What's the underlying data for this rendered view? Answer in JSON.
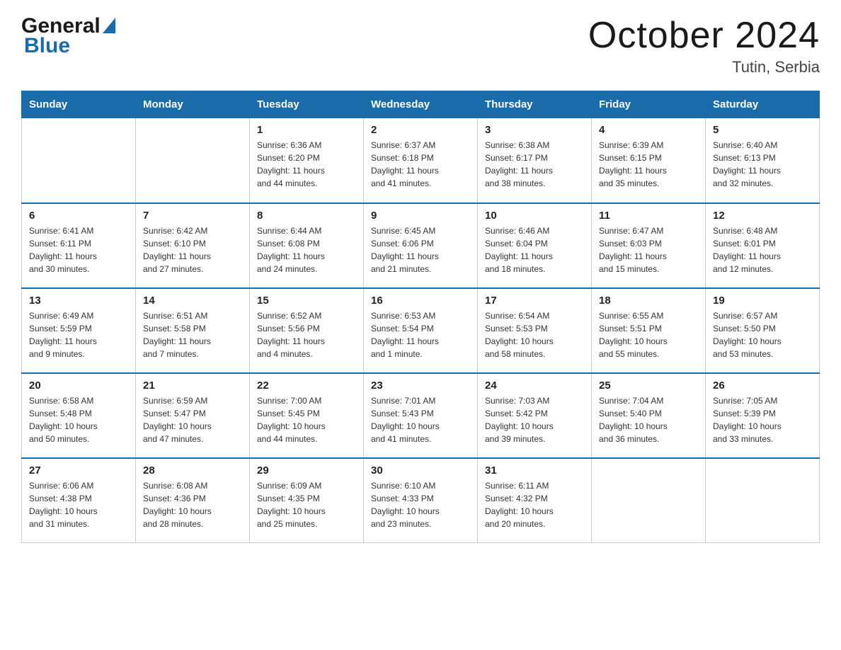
{
  "header": {
    "logo_general": "General",
    "logo_blue": "Blue",
    "month_title": "October 2024",
    "subtitle": "Tutin, Serbia"
  },
  "days_of_week": [
    "Sunday",
    "Monday",
    "Tuesday",
    "Wednesday",
    "Thursday",
    "Friday",
    "Saturday"
  ],
  "weeks": [
    [
      {
        "day": "",
        "info": ""
      },
      {
        "day": "",
        "info": ""
      },
      {
        "day": "1",
        "info": "Sunrise: 6:36 AM\nSunset: 6:20 PM\nDaylight: 11 hours\nand 44 minutes."
      },
      {
        "day": "2",
        "info": "Sunrise: 6:37 AM\nSunset: 6:18 PM\nDaylight: 11 hours\nand 41 minutes."
      },
      {
        "day": "3",
        "info": "Sunrise: 6:38 AM\nSunset: 6:17 PM\nDaylight: 11 hours\nand 38 minutes."
      },
      {
        "day": "4",
        "info": "Sunrise: 6:39 AM\nSunset: 6:15 PM\nDaylight: 11 hours\nand 35 minutes."
      },
      {
        "day": "5",
        "info": "Sunrise: 6:40 AM\nSunset: 6:13 PM\nDaylight: 11 hours\nand 32 minutes."
      }
    ],
    [
      {
        "day": "6",
        "info": "Sunrise: 6:41 AM\nSunset: 6:11 PM\nDaylight: 11 hours\nand 30 minutes."
      },
      {
        "day": "7",
        "info": "Sunrise: 6:42 AM\nSunset: 6:10 PM\nDaylight: 11 hours\nand 27 minutes."
      },
      {
        "day": "8",
        "info": "Sunrise: 6:44 AM\nSunset: 6:08 PM\nDaylight: 11 hours\nand 24 minutes."
      },
      {
        "day": "9",
        "info": "Sunrise: 6:45 AM\nSunset: 6:06 PM\nDaylight: 11 hours\nand 21 minutes."
      },
      {
        "day": "10",
        "info": "Sunrise: 6:46 AM\nSunset: 6:04 PM\nDaylight: 11 hours\nand 18 minutes."
      },
      {
        "day": "11",
        "info": "Sunrise: 6:47 AM\nSunset: 6:03 PM\nDaylight: 11 hours\nand 15 minutes."
      },
      {
        "day": "12",
        "info": "Sunrise: 6:48 AM\nSunset: 6:01 PM\nDaylight: 11 hours\nand 12 minutes."
      }
    ],
    [
      {
        "day": "13",
        "info": "Sunrise: 6:49 AM\nSunset: 5:59 PM\nDaylight: 11 hours\nand 9 minutes."
      },
      {
        "day": "14",
        "info": "Sunrise: 6:51 AM\nSunset: 5:58 PM\nDaylight: 11 hours\nand 7 minutes."
      },
      {
        "day": "15",
        "info": "Sunrise: 6:52 AM\nSunset: 5:56 PM\nDaylight: 11 hours\nand 4 minutes."
      },
      {
        "day": "16",
        "info": "Sunrise: 6:53 AM\nSunset: 5:54 PM\nDaylight: 11 hours\nand 1 minute."
      },
      {
        "day": "17",
        "info": "Sunrise: 6:54 AM\nSunset: 5:53 PM\nDaylight: 10 hours\nand 58 minutes."
      },
      {
        "day": "18",
        "info": "Sunrise: 6:55 AM\nSunset: 5:51 PM\nDaylight: 10 hours\nand 55 minutes."
      },
      {
        "day": "19",
        "info": "Sunrise: 6:57 AM\nSunset: 5:50 PM\nDaylight: 10 hours\nand 53 minutes."
      }
    ],
    [
      {
        "day": "20",
        "info": "Sunrise: 6:58 AM\nSunset: 5:48 PM\nDaylight: 10 hours\nand 50 minutes."
      },
      {
        "day": "21",
        "info": "Sunrise: 6:59 AM\nSunset: 5:47 PM\nDaylight: 10 hours\nand 47 minutes."
      },
      {
        "day": "22",
        "info": "Sunrise: 7:00 AM\nSunset: 5:45 PM\nDaylight: 10 hours\nand 44 minutes."
      },
      {
        "day": "23",
        "info": "Sunrise: 7:01 AM\nSunset: 5:43 PM\nDaylight: 10 hours\nand 41 minutes."
      },
      {
        "day": "24",
        "info": "Sunrise: 7:03 AM\nSunset: 5:42 PM\nDaylight: 10 hours\nand 39 minutes."
      },
      {
        "day": "25",
        "info": "Sunrise: 7:04 AM\nSunset: 5:40 PM\nDaylight: 10 hours\nand 36 minutes."
      },
      {
        "day": "26",
        "info": "Sunrise: 7:05 AM\nSunset: 5:39 PM\nDaylight: 10 hours\nand 33 minutes."
      }
    ],
    [
      {
        "day": "27",
        "info": "Sunrise: 6:06 AM\nSunset: 4:38 PM\nDaylight: 10 hours\nand 31 minutes."
      },
      {
        "day": "28",
        "info": "Sunrise: 6:08 AM\nSunset: 4:36 PM\nDaylight: 10 hours\nand 28 minutes."
      },
      {
        "day": "29",
        "info": "Sunrise: 6:09 AM\nSunset: 4:35 PM\nDaylight: 10 hours\nand 25 minutes."
      },
      {
        "day": "30",
        "info": "Sunrise: 6:10 AM\nSunset: 4:33 PM\nDaylight: 10 hours\nand 23 minutes."
      },
      {
        "day": "31",
        "info": "Sunrise: 6:11 AM\nSunset: 4:32 PM\nDaylight: 10 hours\nand 20 minutes."
      },
      {
        "day": "",
        "info": ""
      },
      {
        "day": "",
        "info": ""
      }
    ]
  ]
}
